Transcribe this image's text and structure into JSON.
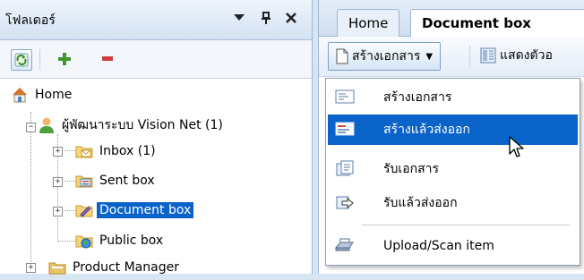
{
  "folder_pane": {
    "title": "โฟลเดอร์",
    "header_icons": [
      "dropdown-arrow-icon",
      "pin-icon",
      "close-icon"
    ],
    "toolbar": {
      "refresh_icon": "refresh-icon",
      "add_icon": "plus-icon",
      "remove_icon": "minus-icon"
    },
    "tree": [
      {
        "label": "Home",
        "icon": "home-icon",
        "level": 0
      },
      {
        "label": "ผู้พัฒนาระบบ Vision Net (1)",
        "icon": "user-icon",
        "level": 1,
        "expanded": true
      },
      {
        "label": "Inbox (1)",
        "icon": "inbox-folder-icon",
        "level": 2
      },
      {
        "label": "Sent box",
        "icon": "sent-folder-icon",
        "level": 2
      },
      {
        "label": "Document box",
        "icon": "document-folder-icon",
        "level": 2,
        "selected": true
      },
      {
        "label": "Public box",
        "icon": "public-folder-icon",
        "level": 2
      },
      {
        "label": "Product Manager",
        "icon": "folder-icon",
        "level": 1
      }
    ]
  },
  "tabs": [
    {
      "label": "Home",
      "active": false
    },
    {
      "label": "Document box",
      "active": true
    }
  ],
  "toolbar": {
    "create_label": "สร้างเอกสาร",
    "show_label": "แสดงตัวอ"
  },
  "menu": {
    "items": [
      {
        "label": "สร้างเอกสาร",
        "icon": "new-document-icon",
        "highlighted": false
      },
      {
        "label": "สร้างแล้วส่งออก",
        "icon": "create-send-icon",
        "highlighted": true
      },
      {
        "label": "รับเอกสาร",
        "icon": "receive-document-icon",
        "highlighted": false
      },
      {
        "label": "รับแล้วส่งออก",
        "icon": "receive-forward-icon",
        "highlighted": false
      },
      {
        "label": "Upload/Scan item",
        "icon": "scanner-icon",
        "highlighted": false
      }
    ]
  },
  "colors": {
    "selection": "#0a63c9",
    "pane_bg": "#d7e4f2",
    "header_grad": "#d4e2f3"
  }
}
